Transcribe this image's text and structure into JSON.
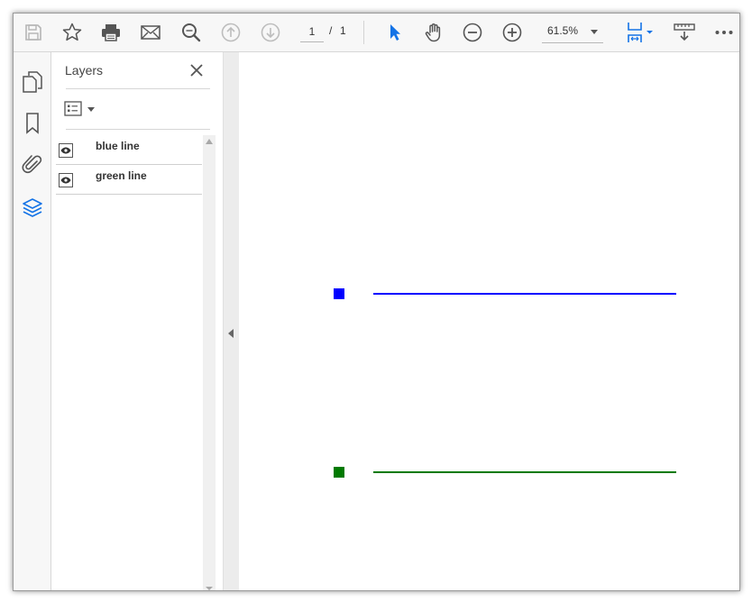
{
  "toolbar": {
    "current_page": "1",
    "page_separator": "/",
    "total_pages": "1",
    "zoom": "61.5%",
    "accent_color": "#1473e6",
    "icons": [
      "save-icon",
      "bookmark-star-icon",
      "print-icon",
      "email-icon",
      "search-icon",
      "previous-page-icon",
      "next-page-icon",
      "select-cursor-icon",
      "hand-tool-icon",
      "zoom-out-icon",
      "zoom-in-icon",
      "page-fit-icon",
      "scrolling-mode-icon",
      "more-icon"
    ]
  },
  "rail": {
    "icons": [
      "pages-icon",
      "bookmarks-icon",
      "attachments-icon",
      "layers-icon"
    ]
  },
  "layers_panel": {
    "title": "Layers",
    "layers": [
      {
        "name": "blue line",
        "visible": true
      },
      {
        "name": "green line",
        "visible": true
      }
    ]
  },
  "document": {
    "items": [
      {
        "label": "blue line",
        "color": "#0000ff"
      },
      {
        "label": "green line",
        "color": "#007a00"
      }
    ]
  }
}
